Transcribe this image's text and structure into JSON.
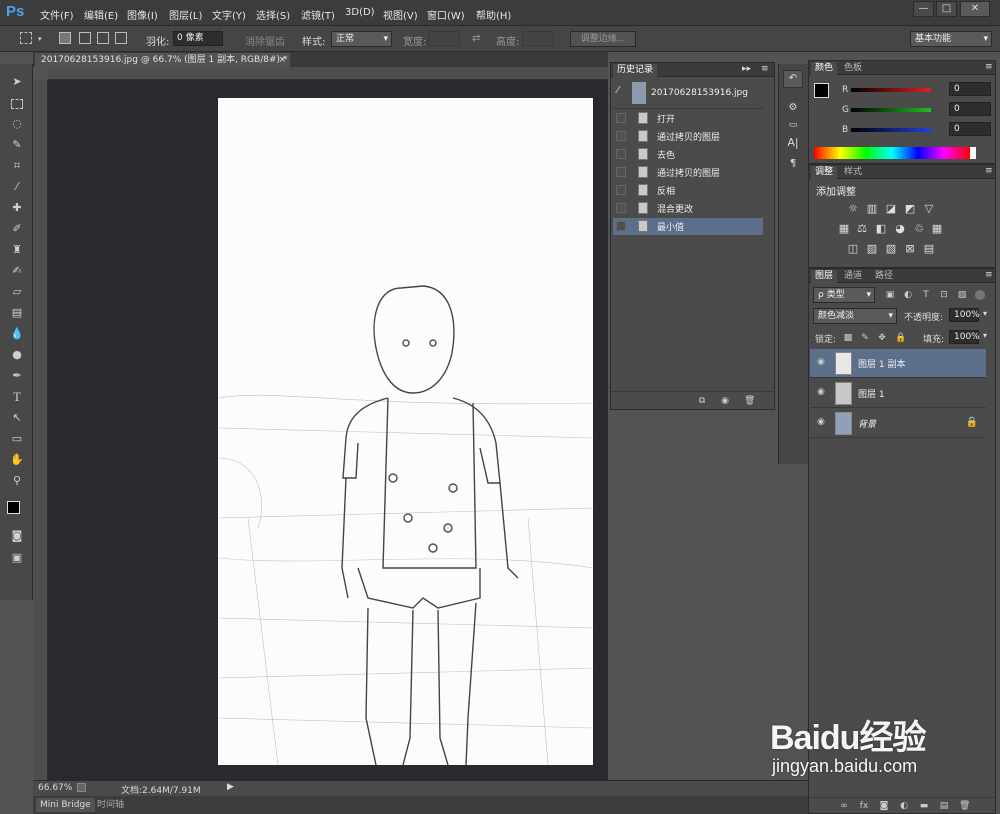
{
  "app": {
    "logo": "Ps"
  },
  "menu": [
    "文件(F)",
    "编辑(E)",
    "图像(I)",
    "图层(L)",
    "文字(Y)",
    "选择(S)",
    "滤镜(T)",
    "3D(D)",
    "视图(V)",
    "窗口(W)",
    "帮助(H)"
  ],
  "window_controls": {
    "minimize": "—",
    "maximize": "□",
    "close": "✕"
  },
  "options": {
    "feather_label": "羽化:",
    "feather_value": "0 像素",
    "antialias_label": "消除锯齿",
    "style_label": "样式:",
    "style_value": "正常",
    "width_label": "宽度:",
    "height_label": "高度:",
    "refine_edge": "调整边缘...",
    "workspace": "基本功能"
  },
  "document": {
    "tab_title": "20170628153916.jpg @ 66.7% (图层 1 副本, RGB/8#) *",
    "zoom": "66.67%",
    "doc_size": "文档:2.64M/7.91M"
  },
  "bottom_tabs": [
    "Mini Bridge",
    "时间轴"
  ],
  "history": {
    "title": "历史记录",
    "snapshot": "20170628153916.jpg",
    "items": [
      "打开",
      "通过拷贝的图层",
      "去色",
      "通过拷贝的图层",
      "反相",
      "混合更改",
      "最小值"
    ],
    "selected_index": 6
  },
  "color_panel": {
    "tabs": [
      "颜色",
      "色板"
    ],
    "channels": [
      {
        "label": "R",
        "value": "0",
        "color": "#e02020"
      },
      {
        "label": "G",
        "value": "0",
        "color": "#20c020"
      },
      {
        "label": "B",
        "value": "0",
        "color": "#2040e0"
      }
    ]
  },
  "adjustments_panel": {
    "tabs": [
      "调整",
      "样式"
    ],
    "add_label": "添加调整"
  },
  "layers_panel": {
    "tabs": [
      "图层",
      "通道",
      "路径"
    ],
    "kind_label": "ρ 类型",
    "blend_mode": "颜色减淡",
    "opacity_label": "不透明度:",
    "opacity_value": "100%",
    "lock_label": "锁定:",
    "fill_label": "填充:",
    "fill_value": "100%",
    "layers": [
      {
        "name": "图层 1 副本",
        "selected": true
      },
      {
        "name": "图层 1",
        "selected": false
      },
      {
        "name": "背景",
        "selected": false,
        "locked": true
      }
    ]
  },
  "watermark": {
    "brand": "Baidu经验",
    "url": "jingyan.baidu.com"
  }
}
